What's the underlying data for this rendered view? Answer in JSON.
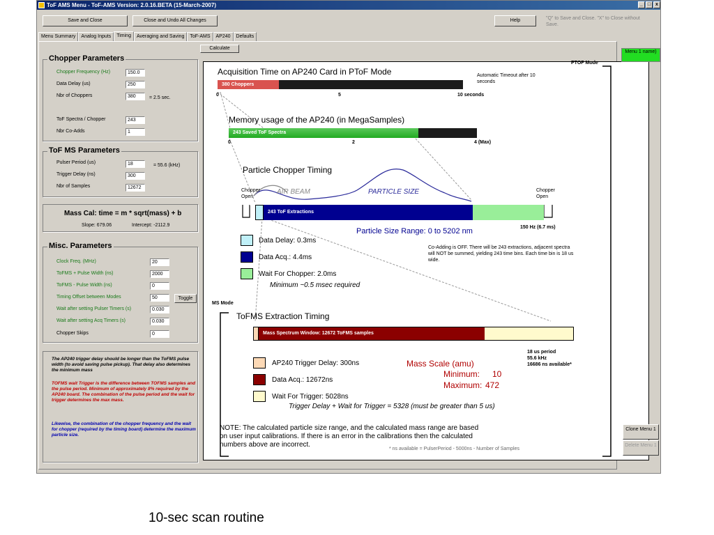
{
  "window": {
    "title": "ToF AMS Menu - ToF-AMS Version: 2.0.16.BETA (15-March-2007)",
    "controls": [
      "_",
      "□",
      "x"
    ]
  },
  "toolbar": {
    "save_close": "Save and Close",
    "close_undo": "Close and Undo All Changes",
    "help": "Help",
    "hint": "\"Q\" to Save and Close. \"X\" to Close without Save."
  },
  "tabs": [
    "Menu Summary",
    "Analog Inputs",
    "Timing",
    "Averaging and Saving",
    "ToF-AMS",
    "AP240",
    "Defaults"
  ],
  "active_tab": "Timing",
  "calculate": "Calculate",
  "chopper": {
    "title": "Chopper Parameters",
    "freq_label": "Chopper Frequency (Hz)",
    "freq_value": "150.0",
    "delay_label": "Data Delay (us)",
    "delay_value": "250",
    "nbr_label": "Nbr of Choppers",
    "nbr_value": "380",
    "nbr_note": "= 2.5 sec.",
    "spectra_label": "ToF Spectra / Chopper",
    "spectra_value": "243",
    "coadds_label": "Nbr Co-Adds",
    "coadds_value": "1"
  },
  "tofms": {
    "title": "ToF MS Parameters",
    "pulser_label": "Pulser Period (us)",
    "pulser_value": "18",
    "pulser_note": "= 55.6 (kHz)",
    "trigger_label": "Trigger Delay (ns)",
    "trigger_value": "300",
    "samples_label": "Nbr of Samples",
    "samples_value": "12672"
  },
  "masscal": {
    "title": "Mass Cal: time = m * sqrt(mass) + b",
    "slope": "Slope: 679.06",
    "intercept": "Intercept: -2112.9"
  },
  "misc": {
    "title": "Misc. Parameters",
    "clock_label": "Clock Freq. (MHz)",
    "clock_value": "20",
    "plus_label": "ToFMS + Pulse Width (ns)",
    "plus_value": "2000",
    "minus_label": "ToFMS - Pulse Width (ns)",
    "minus_value": "0",
    "offset_label": "Timing Offset between Modes",
    "offset_value": "50",
    "toggle": "Toggle",
    "waitp_label": "Wait after setting Pulser Timers (s)",
    "waitp_value": "0.030",
    "waita_label": "Wait after setting Acq Timers (s)",
    "waita_value": "0.030",
    "skips_label": "Chopper Skips",
    "skips_value": "0"
  },
  "notes": {
    "n1": "The AP240 trigger delay should be longer than the ToFMS pulse width (to avoid saving pulse pickup). That delay also determines the minimum mass",
    "n2": "TOFMS wait Trigger is the difference between TOFMS samples and the pulse period.  Minimum of approximately 8% required by the AP240 board.  The combination of the pulse period and the wait for trigger determines the max mass.",
    "n3": "Likewise, the combination of the chopper frequency and the wait for chopper (required by the timing board) determine the maximum particle size."
  },
  "diagram": {
    "ptof_mode": "PTOF Mode",
    "ms_mode": "MS Mode",
    "acq_title": "Acquisition Time on AP240 Card in PToF Mode",
    "acq_bar_label": "380 Choppers",
    "acq_ticks": [
      "0",
      "5",
      "10 seconds"
    ],
    "auto_timeout": "Automatic Timeout after 10 seconds",
    "mem_title": "Memory usage of the AP240 (in MegaSamples)",
    "mem_bar_label": "243 Saved ToF Spectra",
    "mem_ticks": [
      "0",
      "2",
      "4 (Max)"
    ],
    "pct_title": "Particle Chopper Timing",
    "chopper_open_left": "Chopper Open",
    "chopper_open_right": "Chopper Open",
    "air_beam": "AIR BEAM",
    "particle_size": "PARTICLE SIZE",
    "extractions": "243 ToF Extractions",
    "size_range": "Particle Size Range: 0 to 5202 nm",
    "hz": "150 Hz (6.7 ms)",
    "legend_delay": "Data Delay: 0.3ms",
    "legend_acq": "Data Acq.: 4.4ms",
    "legend_wait": "Wait For Chopper: 2.0ms",
    "legend_min": "Minimum ~0.5 msec required",
    "coadd_note": "Co-Adding is OFF.  There will be 243 extractions, adjacent spectra will NOT be summed, yielding 243 time bins.  Each time bin is 18 us wide.",
    "tofms_title": "ToFMS Extraction Timing",
    "ms_window": "Mass Spectrum Window: 12672 ToFMS samples",
    "period": "18 us period",
    "khz": "55.6 kHz",
    "ns_avail": "16686 ns available*",
    "ap_trig": "AP240 Trigger Delay: 300ns",
    "ms_acq": "Data Acq.: 12672ns",
    "ms_wait": "Wait For Trigger: 5028ns",
    "mass_scale": "Mass Scale (amu)",
    "mass_min_label": "Minimum:",
    "mass_min": "10",
    "mass_max_label": "Maximum:",
    "mass_max": "472",
    "trig_eq": "Trigger Delay + Wait for Trigger = 5328 (must be greater than 5 us)",
    "note1": "NOTE:  The calculated particle size range, and the calculated mass range are based",
    "note2": "on user input calibrations.  If there is an error in the calibrations then the calculated",
    "note3": "numbers above are incorrect.",
    "footnote": "* ns available = PulserPeriod - 5000ns - Number of Samples"
  },
  "side": {
    "menu1": "Menu 1 name)",
    "clone": "Clone Menu 1",
    "delete": "Delete Menu 1"
  },
  "caption": "10-sec scan routine",
  "colors": {
    "title_bar": "#0a246a",
    "acq_bar": "#d9534f",
    "mem_bar": "#22aa22",
    "extraction_bar": "#000090",
    "wait_green": "#99ee99",
    "ms_window": "#8b0000",
    "ms_wait": "#fffacd",
    "delay_cyan": "#c0f0f8",
    "ap_trig": "#fcd9b6"
  }
}
